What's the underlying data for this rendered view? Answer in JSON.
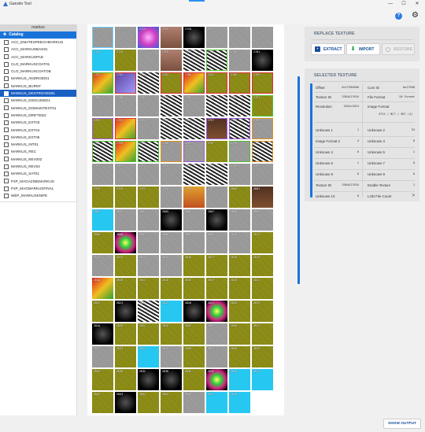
{
  "window": {
    "title": "Gansito Tool",
    "minimize": "—",
    "maximize": "☐",
    "close": "✕"
  },
  "toolbar": {
    "help_label": "?",
    "settings_icon": "gear-icon"
  },
  "tree": {
    "header": "markus",
    "catalog_label": "Catalog",
    "items": [
      "ACC_EMATESPEECHMARKUS",
      "ACC_MARKUSBAG01",
      "ACC_MARKUSPAD",
      "CLO_MARKUSCOAT01",
      "CLO_MARKUSCOATOB",
      "MARKUS_ANDROID01",
      "MARKUS_BURNT",
      "MARKUS_DESTROYED01",
      "MARKUS_DISGUISED1",
      "MARKUS_DOMAINTEXT01",
      "MARKUS_DRIFTED2",
      "MARKUS_EXT03",
      "MARKUS_EXT04",
      "MARKUS_EXT05",
      "MARKUS_INT01",
      "MARKUS_REC",
      "MARKUS_REV002",
      "MARKUS_REV02",
      "MARKUS_SAT01",
      "P4P_MAGAZINEMARKUS",
      "P4P_MAGMARKUSFINAL",
      "WEP_MARKUSKNIFE"
    ],
    "selected_index": 7
  },
  "replace_panel": {
    "header": "REPLACE TEXTURE",
    "extract_label": "EXTRACT",
    "import_label": "IMPORT",
    "restore_label": "RESTORE"
  },
  "selected_panel": {
    "header": "SELECTED TEXTURE",
    "left": [
      {
        "key": "Offset",
        "value": "0x7C390560"
      },
      {
        "key": "Texture ID",
        "value": "3384417634"
      },
      {
        "key": "Resolution",
        "value": "1024×1024"
      },
      {
        "key": "Unknown 1",
        "value": "1"
      },
      {
        "key": "Image Format 2",
        "value": "4"
      },
      {
        "key": "Unknown 4",
        "value": "0"
      },
      {
        "key": "Unknown 6",
        "value": "1"
      },
      {
        "key": "Unknown 8",
        "value": "0"
      },
      {
        "key": "Texture ID",
        "value": "3384417634"
      },
      {
        "key": "Unknown 10",
        "value": "0"
      }
    ],
    "right": [
      {
        "key": "Com ID",
        "value": "0x27E00"
      },
      {
        "key": "File Format",
        "value": "DX Format"
      },
      {
        "key": "Image Format",
        "value": "4712 / BC7 / SRC (4)"
      },
      {
        "key": "Unknown 2",
        "value": "33"
      },
      {
        "key": "Unknown 3",
        "value": "0"
      },
      {
        "key": "Unknown 5",
        "value": "1"
      },
      {
        "key": "Unknown 7",
        "value": "0"
      },
      {
        "key": "Unknown 9",
        "value": "0"
      },
      {
        "key": "Enable Texture",
        "value": "1"
      },
      {
        "key": "LOD File Count",
        "value": ">"
      }
    ]
  },
  "bottom": {
    "show_output_label": "SHOW OUTPUT"
  },
  "colors": {
    "accent": "#1a73d9",
    "olive": "#8a8a10",
    "cyan": "#27c9f2",
    "gray": "#9a9a9a",
    "black": "#0a0a0a",
    "red_border": "#d83030",
    "green_border": "#50c030",
    "purple_border": "#9b59e0",
    "orange_border": "#e09020"
  },
  "thumbnails": {
    "columns": 8,
    "rows": 17,
    "labels": [
      "27C2",
      "27C3",
      "27C4",
      "27C5",
      "27C6",
      "27C7",
      "27C8",
      "27C9",
      "27CA",
      "27CB",
      "27CC",
      "27CD",
      "27CE",
      "27CF",
      "27D0",
      "27D1",
      "27D2",
      "27D3",
      "27D4",
      "27D5",
      "27D6",
      "27D7",
      "27D8",
      "27D9",
      "27DA",
      "27DB",
      "27DC",
      "27DD",
      "27DE",
      "27DF",
      "27E0",
      "27E1",
      "27E2",
      "27E3",
      "27E4",
      "27E5",
      "27E6",
      "27E7",
      "27E8",
      "27E9",
      "27EA",
      "27EB",
      "27EC",
      "27ED",
      "27EE",
      "27EF",
      "27F0",
      "27F1",
      "27F2",
      "27F3",
      "27F4",
      "27F5",
      "27F6",
      "27F7",
      "27F8",
      "27F9",
      "27FA",
      "27FB",
      "27FC",
      "27FD",
      "27FE",
      "27FF",
      "2800",
      "2801",
      "2802",
      "2803",
      "2804",
      "2805",
      "2806",
      "2807",
      "2808",
      "2809",
      "280A",
      "280B",
      "280C",
      "280D",
      "280E",
      "280F",
      "2810",
      "2811",
      "2812",
      "2813",
      "2814",
      "2815",
      "2816",
      "2817",
      "2818",
      "2819",
      "281A",
      "281B",
      "281C",
      "281D",
      "281E",
      "281F",
      "2820",
      "2821",
      "2822",
      "2823",
      "2824",
      "2825",
      "2826",
      "2827",
      "2828",
      "2829",
      "282A",
      "282B",
      "282C",
      "282D",
      "282E",
      "282F",
      "2830",
      "2831",
      "2832",
      "2833",
      "2834",
      "2835",
      "2836",
      "2837",
      "2838",
      "2839",
      "283A",
      "283B",
      "283C",
      "283D",
      "283E",
      "283F",
      "2840",
      "2841",
      "2842",
      "2843",
      "2844",
      "2845",
      "2846",
      "2847",
      "2848"
    ],
    "fills": [
      "gray",
      "gray",
      "magenta",
      "skin",
      "black",
      "gray",
      "gray",
      "gray",
      "cyan",
      "olive",
      "gray",
      "skin",
      "bw",
      "bw",
      "gray",
      "black",
      "red",
      "purple",
      "bw",
      "olive",
      "red",
      "olive",
      "olive",
      "olive",
      "gray",
      "gray",
      "gray",
      "bw",
      "gray",
      "bw",
      "bw",
      "olive",
      "olive",
      "red",
      "gray",
      "bw",
      "bw",
      "brown",
      "bw",
      "gray",
      "bw",
      "red",
      "bw",
      "gray",
      "gray",
      "olive",
      "gray",
      "bw",
      "gray",
      "gray",
      "gray",
      "gray",
      "bw",
      "bw",
      "gray",
      "gray",
      "olive",
      "olive",
      "olive",
      "gray",
      "orange",
      "gray",
      "olive",
      "brown",
      "cyan",
      "gray",
      "gray",
      "black",
      "gray",
      "black",
      "gray",
      "gray",
      "olive",
      "neon",
      "gray",
      "gray",
      "gray",
      "gray",
      "gray",
      "olive",
      "gray",
      "olive",
      "gray",
      "gray",
      "olive",
      "olive",
      "olive",
      "olive",
      "red",
      "olive",
      "olive",
      "olive",
      "olive",
      "olive",
      "olive",
      "olive",
      "olive",
      "black",
      "bw",
      "cyan",
      "black",
      "neon",
      "olive",
      "olive",
      "black",
      "olive",
      "olive",
      "olive",
      "olive",
      "gray",
      "olive",
      "olive",
      "gray",
      "olive",
      "cyan",
      "gray",
      "olive",
      "gray",
      "olive",
      "olive",
      "olive",
      "olive",
      "black",
      "black",
      "olive",
      "neon",
      "cyan",
      "cyan",
      "olive",
      "black",
      "olive",
      "olive",
      "gray",
      "cyan",
      "cyan"
    ],
    "borders": {
      "0": "cyan",
      "13": "green",
      "16": "green",
      "17": "red",
      "19": "red",
      "20": "red",
      "21": "red",
      "22": "red",
      "23": "red",
      "31": "green",
      "32": "purple",
      "33": "red",
      "34": "gray",
      "37": "purple",
      "38": "purple",
      "39": "orange",
      "40": "green",
      "41": "green",
      "42": "green",
      "43": "orange",
      "44": "purple",
      "46": "green",
      "47": "orange"
    }
  }
}
